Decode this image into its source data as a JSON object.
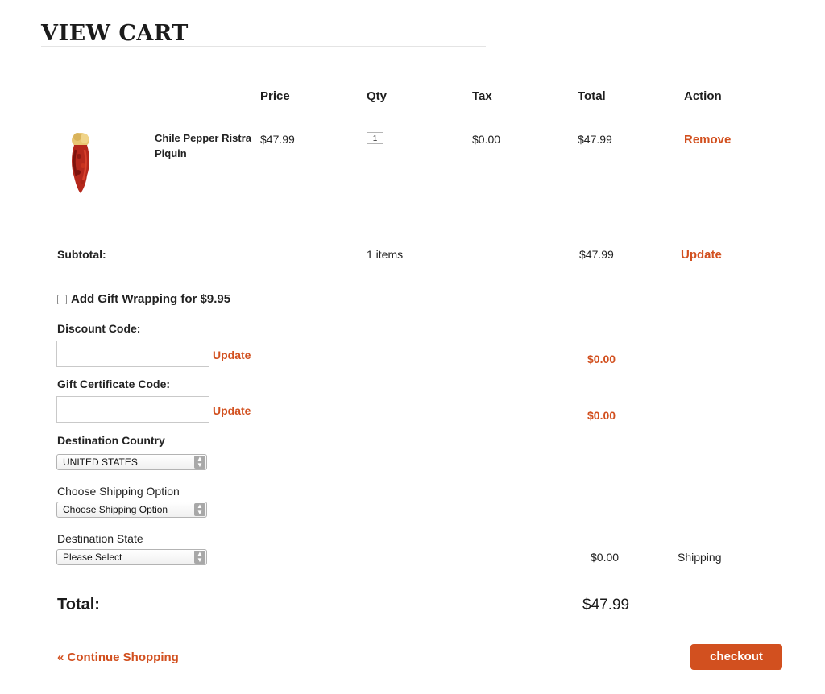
{
  "page": {
    "title": "VIEW CART"
  },
  "table": {
    "headers": {
      "price": "Price",
      "qty": "Qty",
      "tax": "Tax",
      "total": "Total",
      "action": "Action"
    },
    "item": {
      "name_line1": "Chile Pepper Ristra",
      "name_line2": "Piquin",
      "price": "$47.99",
      "qty": "1",
      "tax": "$0.00",
      "total": "$47.99",
      "action": "Remove"
    }
  },
  "summary": {
    "subtotal_label": "Subtotal:",
    "items_count": "1 items",
    "subtotal_value": "$47.99",
    "update_label": "Update"
  },
  "gift_wrap": {
    "label": "Add Gift Wrapping for $9.95",
    "checked": false
  },
  "discount": {
    "label": "Discount Code:",
    "update_label": "Update",
    "value": "$0.00"
  },
  "gift_cert": {
    "label": "Gift Certificate Code:",
    "update_label": "Update",
    "value": "$0.00"
  },
  "destination_country": {
    "label": "Destination Country",
    "selected": "UNITED STATES"
  },
  "shipping_option": {
    "label": "Choose Shipping Option",
    "selected": "Choose Shipping Option"
  },
  "destination_state": {
    "label": "Destination State",
    "selected": "Please Select"
  },
  "shipping": {
    "value": "$0.00",
    "label": "Shipping"
  },
  "total": {
    "label": "Total:",
    "value": "$47.99"
  },
  "footer": {
    "continue_label": "« Continue Shopping",
    "checkout_label": "checkout"
  },
  "colors": {
    "accent": "#d2501f",
    "rule": "#9a9a9a"
  }
}
